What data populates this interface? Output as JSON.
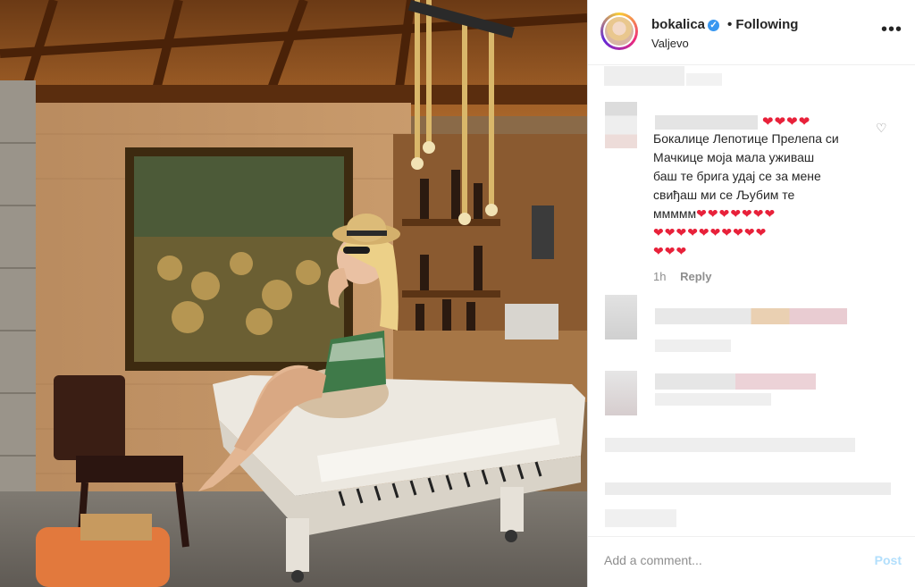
{
  "header": {
    "username": "bokalica",
    "follow_status": "• Following",
    "location": "Valjevo",
    "more_icon": "more-horizontal-icon"
  },
  "comment": {
    "text_lines": [
      "Бокалице Лепотице Прелепа си",
      "Мачкице моја мала уживаш",
      "баш те брига удај се за мене",
      "свиђаш ми се Љубим те"
    ],
    "last_prefix": "ммммм",
    "hearts_top": "❤❤❤❤",
    "hearts_line1": "❤❤❤❤❤❤❤",
    "hearts_line2": "❤❤❤❤❤❤❤❤❤❤",
    "hearts_line3": "❤❤❤",
    "time": "1h",
    "reply_label": "Reply",
    "like_icon": "heart-outline-icon"
  },
  "composer": {
    "placeholder": "Add a comment...",
    "post_label": "Post"
  },
  "colors": {
    "verified": "#3897f0",
    "heart": "#e8213a",
    "post_disabled": "#b2dffc"
  }
}
